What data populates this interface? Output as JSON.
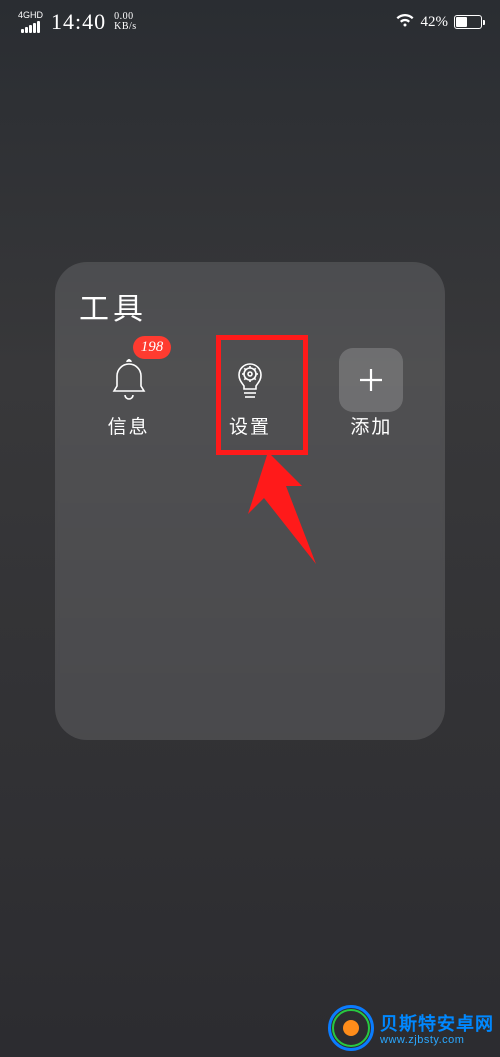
{
  "status_bar": {
    "network_label": "4GHD",
    "time": "14:40",
    "net_speed_value": "0.00",
    "net_speed_unit": "KB/s",
    "battery_text": "42%"
  },
  "folder": {
    "title": "工具",
    "apps": [
      {
        "label": "信息",
        "icon": "bell-icon",
        "badge": "198"
      },
      {
        "label": "设置",
        "icon": "gear-bulb-icon"
      },
      {
        "label": "添加",
        "icon": "plus-icon"
      }
    ]
  },
  "watermark": {
    "brand": "贝斯特安卓网",
    "url": "www.zjbsty.com"
  }
}
